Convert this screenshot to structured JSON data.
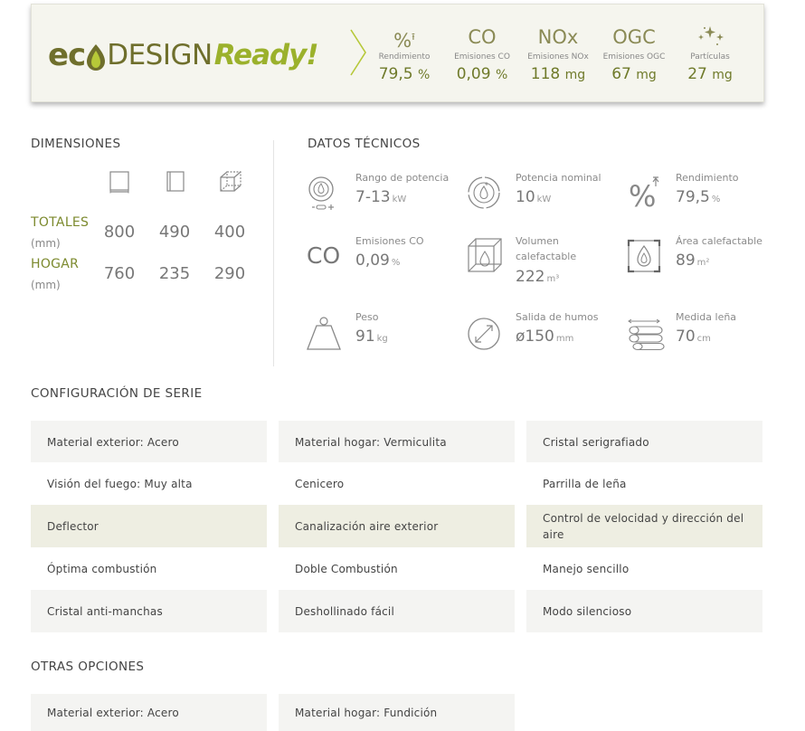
{
  "ecodesign": {
    "logo_eco": "ec",
    "logo_design": "DESIGN",
    "logo_ready": "Ready!",
    "stats": [
      {
        "symbol": "%",
        "label": "Rendimiento",
        "value": "79,5",
        "unit": "%"
      },
      {
        "symbol": "CO",
        "label": "Emisiones CO",
        "value": "0,09",
        "unit": "%"
      },
      {
        "symbol": "NOx",
        "label": "Emisiones NOx",
        "value": "118",
        "unit": "mg"
      },
      {
        "symbol": "OGC",
        "label": "Emisiones OGC",
        "value": "67",
        "unit": "mg"
      },
      {
        "symbol": "",
        "label": "Partículas",
        "value": "27",
        "unit": "mg"
      }
    ],
    "icons": [
      "percent-icon",
      "sparkle-icon"
    ]
  },
  "dimensions": {
    "title": "DIMENSIONES",
    "icons": [
      "width-icon",
      "height-icon",
      "depth-icon"
    ],
    "rows": [
      {
        "label": "TOTALES",
        "unit": "(mm)",
        "values": [
          "800",
          "490",
          "400"
        ]
      },
      {
        "label": "HOGAR",
        "unit": "(mm)",
        "values": [
          "760",
          "235",
          "290"
        ]
      }
    ]
  },
  "tech": {
    "title": "DATOS TÉCNICOS",
    "items": [
      {
        "label": "Rango de potencia",
        "value": "7-13",
        "unit": "kW",
        "icon": "power-range-icon"
      },
      {
        "label": "Potencia nominal",
        "value": "10",
        "unit": "kW",
        "icon": "nominal-power-icon"
      },
      {
        "label": "Rendimiento",
        "value": "79,5",
        "unit": "%",
        "icon": "efficiency-icon"
      },
      {
        "label": "Emisiones CO",
        "value": "0,09",
        "unit": "%",
        "icon": "co-emissions-icon",
        "symbol": "CO"
      },
      {
        "label": "Volumen calefactable",
        "value": "222",
        "unit": "m³",
        "icon": "volume-icon"
      },
      {
        "label": "Área calefactable",
        "value": "89",
        "unit": "m²",
        "icon": "area-icon"
      },
      {
        "label": "Peso",
        "value": "91",
        "unit": "kg",
        "icon": "weight-icon"
      },
      {
        "label": "Salida de humos",
        "value": "ø150",
        "unit": "mm",
        "icon": "flue-outlet-icon"
      },
      {
        "label": "Medida leña",
        "value": "70",
        "unit": "cm",
        "icon": "firewood-icon"
      }
    ]
  },
  "series_config": {
    "title": "CONFIGURACIÓN DE SERIE",
    "items": [
      "Material exterior: Acero",
      "Material hogar: Vermiculita",
      "Cristal serigrafiado",
      "Visión del fuego: Muy alta",
      "Cenicero",
      "Parrilla de leña",
      "Deflector",
      "Canalización aire exterior",
      "Control de velocidad y dirección del aire",
      "Óptima combustión",
      "Doble Combustión",
      "Manejo sencillo",
      "Cristal anti-manchas",
      "Deshollinado fácil",
      "Modo silencioso"
    ]
  },
  "other_options": {
    "title": "OTRAS OPCIONES",
    "items": [
      "Material exterior: Acero",
      "Material hogar: Fundición"
    ]
  },
  "colors": {
    "brand_olive": "#6f6f2c",
    "brand_green": "#9bb12c",
    "label_green": "#7c8a2e",
    "banner_bg": "#f5f5ee",
    "row_shade": "#eeeee2",
    "cell_shade": "#f4f4f2"
  }
}
